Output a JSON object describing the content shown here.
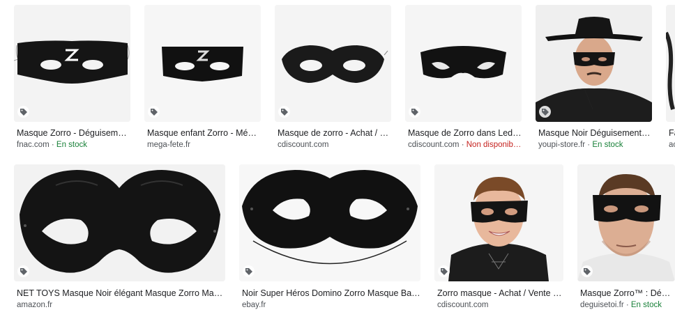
{
  "results": [
    {
      "title": "Masque Zorro - Déguiseme…",
      "source": "fnac.com",
      "status": "En stock",
      "status_type": "ok",
      "image_icon": "domino-mask-z-icon"
    },
    {
      "title": "Masque enfant Zorro - Még…",
      "source": "mega-fete.fr",
      "status": "",
      "status_type": "",
      "image_icon": "domino-mask-z-icon"
    },
    {
      "title": "Masque de zorro - Achat / …",
      "source": "cdiscount.com",
      "status": "",
      "status_type": "",
      "image_icon": "domino-mask-icon"
    },
    {
      "title": "Masque de Zorro dans Led…",
      "source": "cdiscount.com",
      "status": "Non disponib…",
      "status_type": "bad",
      "image_icon": "visor-mask-icon"
    },
    {
      "title": "Masque Noir Déguisement …",
      "source": "youpi-store.fr",
      "status": "En stock",
      "status_type": "ok",
      "image_icon": "man-in-zorro-hat-icon"
    },
    {
      "title": "Fa",
      "source": "ac",
      "status": "",
      "status_type": "",
      "image_icon": "partial-image-icon"
    },
    {
      "title": "NET TOYS Masque Noir élégant Masque Zorro Mas…",
      "source": "amazon.fr",
      "status": "",
      "status_type": "",
      "image_icon": "domino-mask-icon"
    },
    {
      "title": "Noir Super Héros Domino Zorro Masque Ba…",
      "source": "ebay.fr",
      "status": "",
      "status_type": "",
      "image_icon": "domino-mask-icon"
    },
    {
      "title": "Zorro masque - Achat / Vente …",
      "source": "cdiscount.com",
      "status": "",
      "status_type": "",
      "image_icon": "child-in-mask-icon"
    },
    {
      "title": "Masque Zorro™ : Dégu…",
      "source": "deguisetoi.fr",
      "status": "En stock",
      "status_type": "ok",
      "image_icon": "man-in-mask-icon"
    }
  ],
  "separator": " · ",
  "colors": {
    "in_stock": "#188038",
    "unavailable": "#c5221f",
    "mask": "#151515"
  },
  "shopping_tag_icon": "shopping-tag-icon"
}
